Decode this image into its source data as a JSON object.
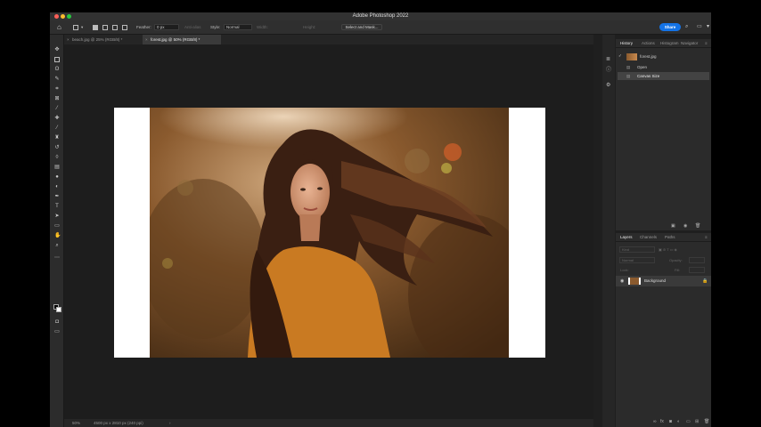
{
  "app": {
    "title": "Adobe Photoshop 2022",
    "traffic_colors": [
      "#ff5f57",
      "#febc2e",
      "#28c840"
    ]
  },
  "options_bar": {
    "feather_label": "Feather:",
    "feather_value": "0 px",
    "antialias_label": "Anti-alias",
    "style_label": "Style:",
    "style_value": "Normal",
    "width_label": "Width:",
    "height_label": "Height:",
    "select_mask_label": "Select and Mask...",
    "share_label": "Share"
  },
  "tabs": [
    {
      "label": "beach.jpg @ 25% (RGB/8) *",
      "active": false
    },
    {
      "label": "forest.jpg @ 50% (RGB/8) *",
      "active": true
    }
  ],
  "status": {
    "zoom": "50%",
    "doc_info": "4500 px x 2810 px (240 ppi)",
    "arrow": "›"
  },
  "history_panel": {
    "tabs": [
      "History",
      "Actions",
      "Histogram",
      "Navigator"
    ],
    "snapshot": "forest.jpg",
    "states": [
      "Open",
      "Canvas Size"
    ]
  },
  "layers_panel": {
    "tabs": [
      "Layers",
      "Channels",
      "Paths"
    ],
    "filter_placeholder": "Kind",
    "blend_mode": "Normal",
    "opacity_label": "Opacity:",
    "lock_label": "Lock:",
    "fill_label": "Fill:",
    "layers": [
      {
        "name": "Background",
        "locked": true,
        "visible": true
      }
    ]
  },
  "colors": {
    "accent": "#1473e6",
    "foreground_swatch": "#000000",
    "background_swatch": "#ffffff"
  }
}
